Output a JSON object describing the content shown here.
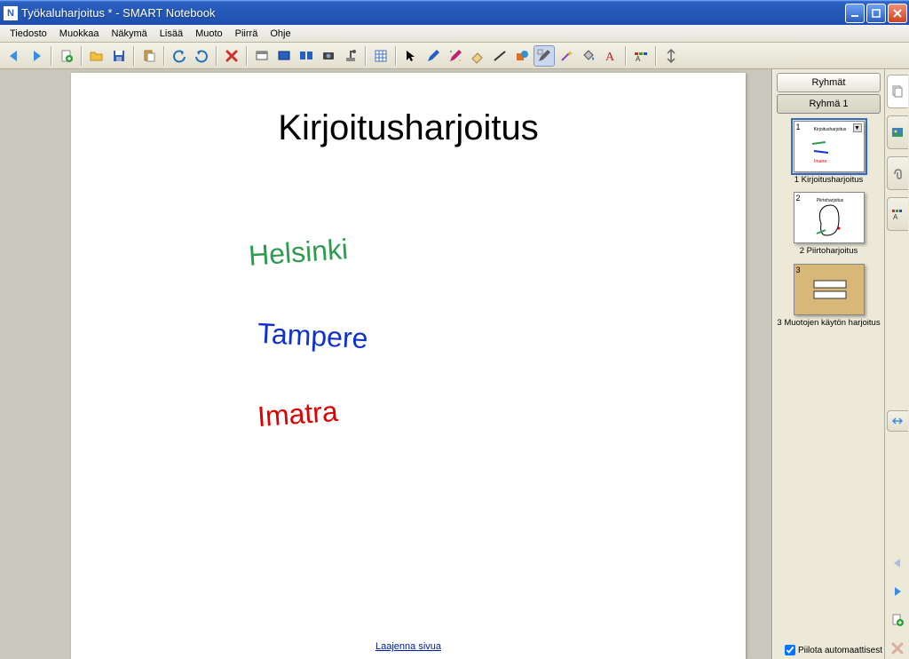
{
  "window": {
    "title": "Työkaluharjoitus * - SMART Notebook"
  },
  "menu": {
    "items": [
      "Tiedosto",
      "Muokkaa",
      "Näkymä",
      "Lisää",
      "Muoto",
      "Piirrä",
      "Ohje"
    ]
  },
  "canvas": {
    "heading": "Kirjoitusharjoitus",
    "city1": "Helsinki",
    "city2": "Tampere",
    "city3": "Imatra",
    "extend_link": "Laajenna sivua"
  },
  "sidebar": {
    "groups_btn": "Ryhmät",
    "group1_btn": "Ryhmä 1",
    "thumbs": [
      {
        "num": "1",
        "label": "1 Kirjoitusharjoitus",
        "selected": true,
        "mini": "Kirjoitusharjoitus"
      },
      {
        "num": "2",
        "label": "2 Piirtoharjoitus",
        "selected": false,
        "mini": "Piirtoharjoitus"
      },
      {
        "num": "3",
        "label": "3 Muotojen käytön harjoitus",
        "selected": false,
        "mini": ""
      }
    ],
    "autohide": "Piilota automaattisest"
  },
  "colors": {
    "green": "#2d9c4f",
    "blue": "#1030d0",
    "red": "#e00000"
  }
}
